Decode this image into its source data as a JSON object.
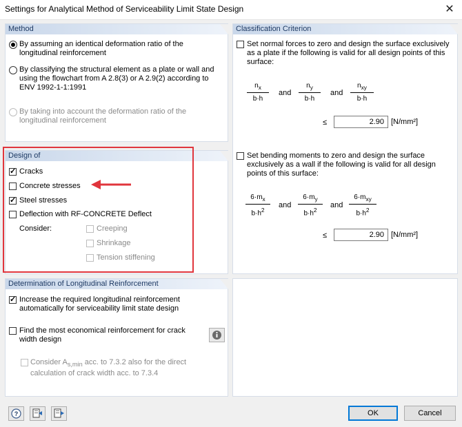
{
  "window": {
    "title": "Settings for Analytical Method of Serviceability Limit State Design",
    "close_glyph": "✕"
  },
  "method": {
    "heading": "Method",
    "options": [
      {
        "label": "By assuming an identical deformation ratio of the longitudinal reinforcement",
        "selected": true,
        "enabled": true
      },
      {
        "label": "By classifying the structural element as a plate or wall and using the flowchart from A 2.8(3) or A 2.9(2) according to ENV 1992-1-1:1991",
        "selected": false,
        "enabled": true
      },
      {
        "label": "By taking into account the deformation ratio of the longitudinal reinforcement",
        "selected": false,
        "enabled": false
      }
    ]
  },
  "classification": {
    "heading": "Classification Criterion",
    "plate": {
      "label": "Set normal forces to zero and design the surface exclusively as a plate if the following is valid for all design points of this surface:",
      "checked": false,
      "fractions": [
        {
          "num_base": "n",
          "num_sub": "x",
          "den_base": "b·h",
          "den_sup": ""
        },
        {
          "num_base": "n",
          "num_sub": "y",
          "den_base": "b·h",
          "den_sup": ""
        },
        {
          "num_base": "n",
          "num_sub": "xy",
          "den_base": "b·h",
          "den_sup": ""
        }
      ],
      "and": "and",
      "le": "≤",
      "value": "2.90",
      "unit": "[N/mm²]"
    },
    "wall": {
      "label": "Set bending moments to zero and design the surface exclusively as a wall if the following is valid for all design points of this surface:",
      "checked": false,
      "fractions": [
        {
          "num_base": "6·m",
          "num_sub": "x",
          "den_base": "b·h",
          "den_sup": "2"
        },
        {
          "num_base": "6·m",
          "num_sub": "y",
          "den_base": "b·h",
          "den_sup": "2"
        },
        {
          "num_base": "6·m",
          "num_sub": "xy",
          "den_base": "b·h",
          "den_sup": "2"
        }
      ],
      "and": "and",
      "le": "≤",
      "value": "2.90",
      "unit": "[N/mm²]"
    }
  },
  "design_of": {
    "heading": "Design of",
    "items": [
      {
        "label": "Cracks",
        "checked": true
      },
      {
        "label": "Concrete stresses",
        "checked": false
      },
      {
        "label": "Steel stresses",
        "checked": true
      },
      {
        "label": "Deflection with RF-CONCRETE Deflect",
        "checked": false
      }
    ],
    "consider_label": "Consider:",
    "consider": [
      {
        "label": "Creeping",
        "checked": false
      },
      {
        "label": "Shrinkage",
        "checked": false
      },
      {
        "label": "Tension stiffening",
        "checked": false
      }
    ],
    "highlight_color": "#e0353c"
  },
  "longitudinal": {
    "heading": "Determination of Longitudinal Reinforcement",
    "increase": {
      "label": "Increase the required longitudinal reinforcement automatically for serviceability limit state design",
      "checked": true
    },
    "economical": {
      "label": "Find the most economical reinforcement for crack width design",
      "checked": false
    },
    "consider_as": {
      "label_pre": "Consider A",
      "label_sub": "s,min",
      "label_post": " acc. to 7.3.2 also for the direct calculation of crack width acc. to 7.3.4",
      "checked": false
    }
  },
  "footer": {
    "ok": "OK",
    "cancel": "Cancel"
  }
}
